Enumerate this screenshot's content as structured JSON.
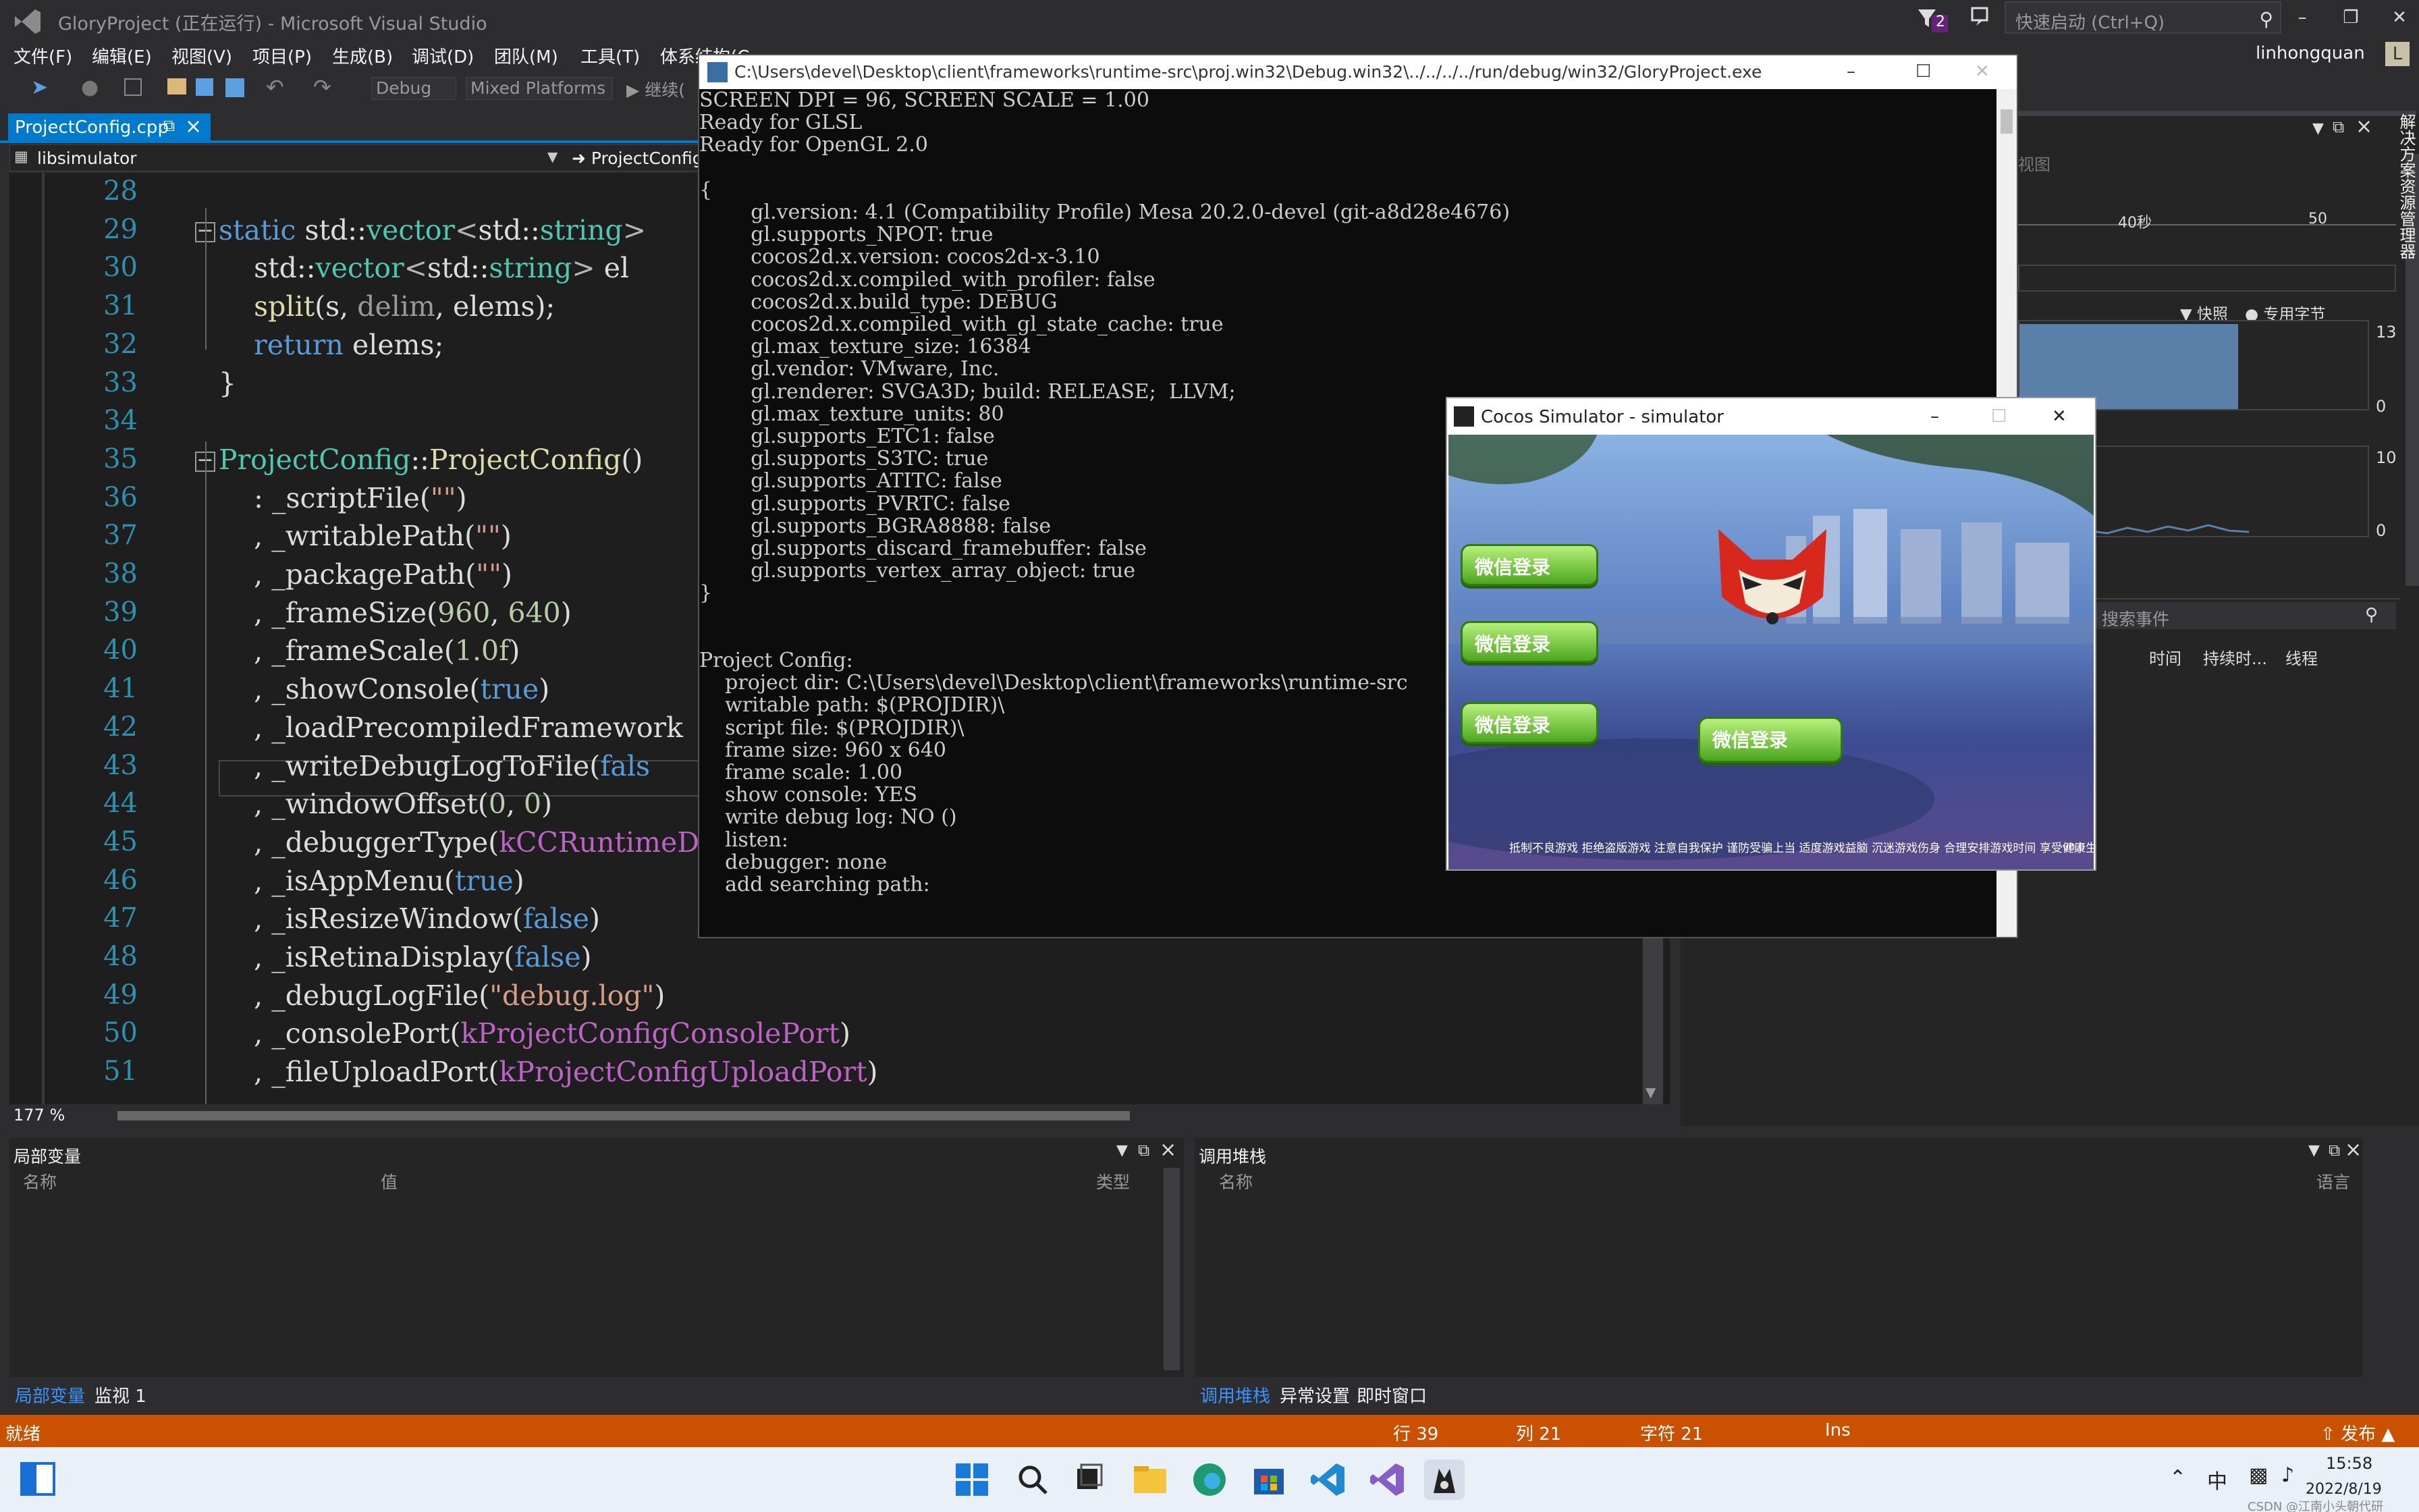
{
  "vs": {
    "title": "GloryProject (正在运行) - Microsoft Visual Studio",
    "filter_count": "2",
    "quick_launch_placeholder": "快速启动 (Ctrl+Q)",
    "user": "linhongquan",
    "avatar": "L",
    "menu": [
      "文件(F)",
      "编辑(E)",
      "视图(V)",
      "项目(P)",
      "生成(B)",
      "调试(D)",
      "团队(M)",
      "工具(T)",
      "体系结构(C"
    ],
    "toolbar": {
      "config": "Debug",
      "platform": "Mixed Platforms",
      "continue": "继续("
    },
    "doc_tab": "ProjectConfig.cpp",
    "nav_project": "libsimulator",
    "nav_scope": "ProjectConfig",
    "zoom": "177 %",
    "side_label": "解决方案资源管理器"
  },
  "code": [
    {
      "n": "28",
      "segs": []
    },
    {
      "n": "29",
      "fold": true,
      "segs": [
        [
          "kw",
          "static "
        ],
        [
          "pl",
          "std::"
        ],
        [
          "ty",
          "vector"
        ],
        [
          "pu",
          "<"
        ],
        [
          "pl",
          "std::"
        ],
        [
          "ty",
          "string"
        ],
        [
          "pu",
          ">"
        ]
      ]
    },
    {
      "n": "30",
      "segs": [
        [
          "pl",
          "    std::"
        ],
        [
          "ty",
          "vector"
        ],
        [
          "pu",
          "<"
        ],
        [
          "pl",
          "std::"
        ],
        [
          "ty",
          "string"
        ],
        [
          "pu",
          "> "
        ],
        [
          "pl",
          "el"
        ]
      ]
    },
    {
      "n": "31",
      "segs": [
        [
          "pl",
          "    "
        ],
        [
          "fn",
          "split"
        ],
        [
          "pl",
          "(s, "
        ],
        [
          "pa",
          "delim"
        ],
        [
          "pl",
          ", elems);"
        ]
      ]
    },
    {
      "n": "32",
      "segs": [
        [
          "pl",
          "    "
        ],
        [
          "kw",
          "return "
        ],
        [
          "pl",
          "elems;"
        ]
      ]
    },
    {
      "n": "33",
      "segs": [
        [
          "pl",
          "}"
        ]
      ]
    },
    {
      "n": "34",
      "segs": []
    },
    {
      "n": "35",
      "fold": true,
      "segs": [
        [
          "ty",
          "ProjectConfig"
        ],
        [
          "pl",
          "::"
        ],
        [
          "fn",
          "ProjectConfig"
        ],
        [
          "pl",
          "()"
        ]
      ]
    },
    {
      "n": "36",
      "segs": [
        [
          "pl",
          "    : _scriptFile("
        ],
        [
          "st",
          "\"\""
        ],
        [
          "pl",
          ")"
        ]
      ]
    },
    {
      "n": "37",
      "segs": [
        [
          "pl",
          "    , _writablePath("
        ],
        [
          "st",
          "\"\""
        ],
        [
          "pl",
          ")"
        ]
      ]
    },
    {
      "n": "38",
      "segs": [
        [
          "pl",
          "    , _packagePath("
        ],
        [
          "st",
          "\"\""
        ],
        [
          "pl",
          ")"
        ]
      ]
    },
    {
      "n": "39",
      "segs": [
        [
          "pl",
          "    , _frameSize("
        ],
        [
          "nu",
          "960"
        ],
        [
          "pl",
          ", "
        ],
        [
          "nu",
          "640"
        ],
        [
          "pl",
          ")"
        ]
      ]
    },
    {
      "n": "40",
      "segs": [
        [
          "pl",
          "    , _frameScale("
        ],
        [
          "nu",
          "1.0f"
        ],
        [
          "pl",
          ")"
        ]
      ]
    },
    {
      "n": "41",
      "segs": [
        [
          "pl",
          "    , _showConsole("
        ],
        [
          "kw",
          "true"
        ],
        [
          "pl",
          ")"
        ]
      ]
    },
    {
      "n": "42",
      "segs": [
        [
          "pl",
          "    , _loadPrecompiledFramework"
        ]
      ]
    },
    {
      "n": "43",
      "segs": [
        [
          "pl",
          "    , _writeDebugLogToFile("
        ],
        [
          "kw",
          "fals"
        ]
      ]
    },
    {
      "n": "44",
      "segs": [
        [
          "pl",
          "    , _windowOffset("
        ],
        [
          "nu",
          "0"
        ],
        [
          "pl",
          ", "
        ],
        [
          "nu",
          "0"
        ],
        [
          "pl",
          ")"
        ]
      ]
    },
    {
      "n": "45",
      "segs": [
        [
          "pl",
          "    , _debuggerType("
        ],
        [
          "ma",
          "kCCRuntimeD"
        ]
      ]
    },
    {
      "n": "46",
      "segs": [
        [
          "pl",
          "    , _isAppMenu("
        ],
        [
          "kw",
          "true"
        ],
        [
          "pl",
          ")"
        ]
      ]
    },
    {
      "n": "47",
      "segs": [
        [
          "pl",
          "    , _isResizeWindow("
        ],
        [
          "kw",
          "false"
        ],
        [
          "pl",
          ")"
        ]
      ]
    },
    {
      "n": "48",
      "segs": [
        [
          "pl",
          "    , _isRetinaDisplay("
        ],
        [
          "kw",
          "false"
        ],
        [
          "pl",
          ")"
        ]
      ]
    },
    {
      "n": "49",
      "segs": [
        [
          "pl",
          "    , _debugLogFile("
        ],
        [
          "st",
          "\"debug.log\""
        ],
        [
          "pl",
          ")"
        ]
      ]
    },
    {
      "n": "50",
      "segs": [
        [
          "pl",
          "    , _consolePort("
        ],
        [
          "ma",
          "kProjectConfigConsolePort"
        ],
        [
          "pl",
          ")"
        ]
      ]
    },
    {
      "n": "51",
      "segs": [
        [
          "pl",
          "    , _fileUploadPort("
        ],
        [
          "ma",
          "kProjectConfigUploadPort"
        ],
        [
          "pl",
          ")"
        ]
      ]
    }
  ],
  "console": {
    "title": "C:\\Users\\devel\\Desktop\\client\\frameworks\\runtime-src\\proj.win32\\Debug.win32\\../../../../run/debug/win32/GloryProject.exe",
    "lines": [
      "SCREEN DPI = 96, SCREEN SCALE = 1.00",
      "Ready for GLSL",
      "Ready for OpenGL 2.0",
      "",
      "{",
      "        gl.version: 4.1 (Compatibility Profile) Mesa 20.2.0-devel (git-a8d28e4676)",
      "        gl.supports_NPOT: true",
      "        cocos2d.x.version: cocos2d-x-3.10",
      "        cocos2d.x.compiled_with_profiler: false",
      "        cocos2d.x.build_type: DEBUG",
      "        cocos2d.x.compiled_with_gl_state_cache: true",
      "        gl.max_texture_size: 16384",
      "        gl.vendor: VMware, Inc.",
      "        gl.renderer: SVGA3D; build: RELEASE;  LLVM;",
      "        gl.max_texture_units: 80",
      "        gl.supports_ETC1: false",
      "        gl.supports_S3TC: true",
      "        gl.supports_ATITC: false",
      "        gl.supports_PVRTC: false",
      "        gl.supports_BGRA8888: false",
      "        gl.supports_discard_framebuffer: false",
      "        gl.supports_vertex_array_object: true",
      "}",
      "",
      "",
      "Project Config:",
      "    project dir: C:\\Users\\devel\\Desktop\\client\\frameworks\\runtime-src",
      "    writable path: $(PROJDIR)\\",
      "    script file: $(PROJDIR)\\",
      "    frame size: 960 x 640",
      "    frame scale: 1.00",
      "    show console: YES",
      "    write debug log: NO ()",
      "    listen:",
      "    debugger: none",
      "    add searching path:"
    ]
  },
  "simulator": {
    "title": "Cocos Simulator - simulator",
    "button_label": "微信登录",
    "footer": "抵制不良游戏 拒绝盗版游戏 注意自我保护 谨防受骗上当 适度游戏益脑 沉迷游戏伤身 合理安排游戏时间 享受健康生活",
    "version": "v0.0"
  },
  "diag": {
    "partial_view": "视图",
    "timeline_40": "40秒",
    "timeline_50": "50",
    "legend_snapshot": "快照",
    "legend_private": "专用字节",
    "mem_max": "13",
    "mem_min": "0",
    "cpu_max": "10",
    "cpu_min": "0",
    "search_events": "搜索事件",
    "col_time": "时间",
    "col_duration": "持续时...",
    "col_thread": "线程"
  },
  "locals": {
    "title": "局部变量",
    "col_name": "名称",
    "col_value": "值",
    "col_type": "类型",
    "tab_locals": "局部变量",
    "tab_watch": "监视 1"
  },
  "callstack": {
    "title": "调用堆栈",
    "col_name": "名称",
    "col_lang": "语言",
    "tab_callstack": "调用堆栈",
    "tab_exceptions": "异常设置",
    "tab_immediate": "即时窗口"
  },
  "status": {
    "ready": "就绪",
    "row": "行 39",
    "col": "列 21",
    "char": "字符 21",
    "ins": "Ins",
    "publish": "发布"
  },
  "taskbar": {
    "ime": "中",
    "time": "15:58",
    "date": "2022/8/19",
    "watermark": "CSDN @江南小头朝代研"
  }
}
